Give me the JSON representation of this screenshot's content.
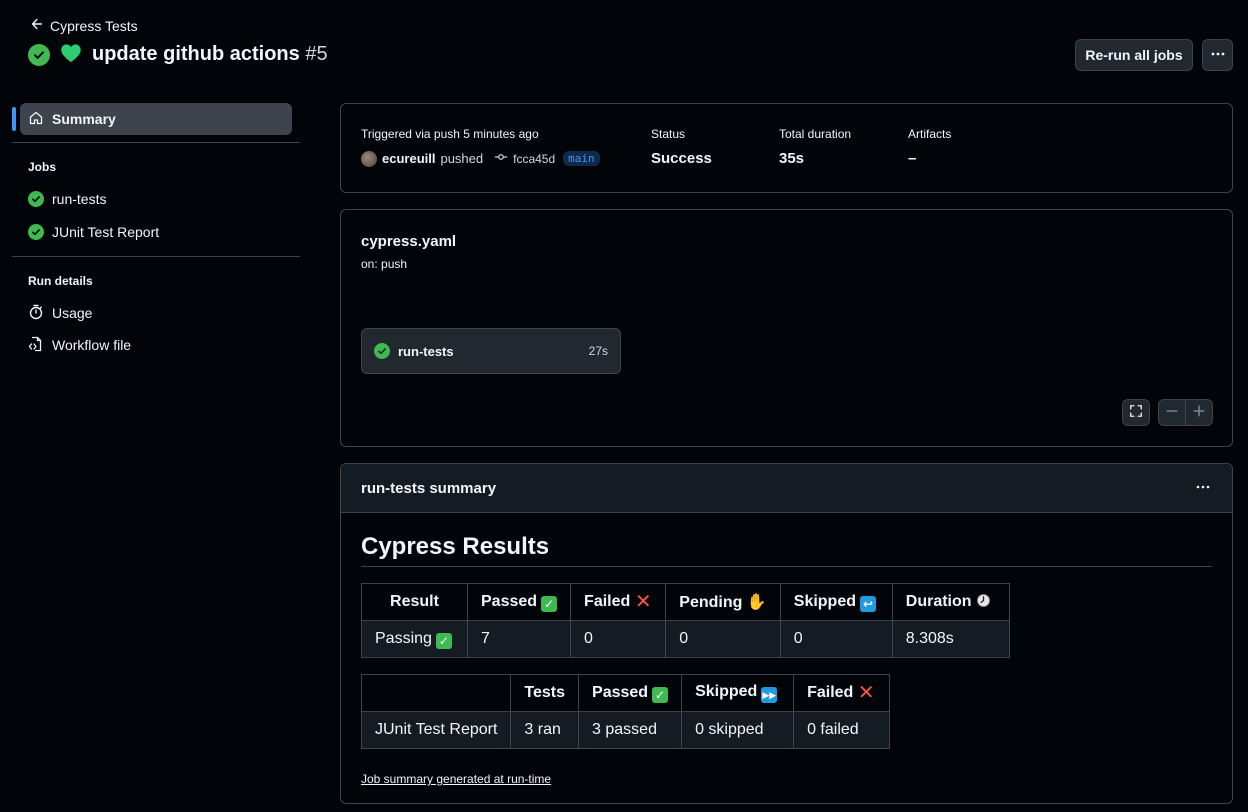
{
  "header": {
    "back_label": "Cypress Tests",
    "emoji_label": "💚",
    "title": "update github actions",
    "run_number": "#5",
    "rerun_label": "Re-run all jobs",
    "more_icon": "kebab-horizontal-icon"
  },
  "sidebar": {
    "summary_label": "Summary",
    "jobs_heading": "Jobs",
    "jobs": [
      {
        "label": "run-tests",
        "status": "success"
      },
      {
        "label": "JUnit Test Report",
        "status": "success"
      }
    ],
    "run_details_heading": "Run details",
    "details": [
      {
        "label": "Usage",
        "icon": "stopwatch-icon"
      },
      {
        "label": "Workflow file",
        "icon": "file-code-icon"
      }
    ]
  },
  "run_info": {
    "trigger_label": "Triggered via push 5 minutes ago",
    "user": "ecureuill",
    "action": "pushed",
    "commit": "fcca45d",
    "branch": "main",
    "status_label": "Status",
    "status_value": "Success",
    "duration_label": "Total duration",
    "duration_value": "35s",
    "artifacts_label": "Artifacts",
    "artifacts_value": "–"
  },
  "workflow": {
    "file": "cypress.yaml",
    "trigger": "on: push",
    "job_label": "run-tests",
    "job_duration": "27s"
  },
  "summary": {
    "header": "run-tests summary",
    "heading": "Cypress Results",
    "cypress_table": {
      "headers": [
        "Result",
        "Passed",
        "Failed",
        "Pending",
        "Skipped",
        "Duration"
      ],
      "header_emojis": [
        "",
        "✅",
        "❌",
        "✋",
        "↩️",
        "🕗"
      ],
      "row": [
        "Passing",
        "7",
        "0",
        "0",
        "0",
        "8.308s"
      ],
      "row_emoji": "✅"
    },
    "junit_table": {
      "headers": [
        "",
        "Tests",
        "Passed",
        "Skipped",
        "Failed"
      ],
      "header_emojis": [
        "",
        "",
        "✅",
        "⏭️",
        "❌"
      ],
      "row": [
        "JUnit Test Report",
        "3 ran",
        "3 passed",
        "0 skipped",
        "0 failed"
      ]
    },
    "footer_link": "Job summary generated at run-time"
  },
  "colors": {
    "success": "#3fb950",
    "accent": "#4493f8",
    "background": "#010409",
    "border": "#3d444d"
  }
}
